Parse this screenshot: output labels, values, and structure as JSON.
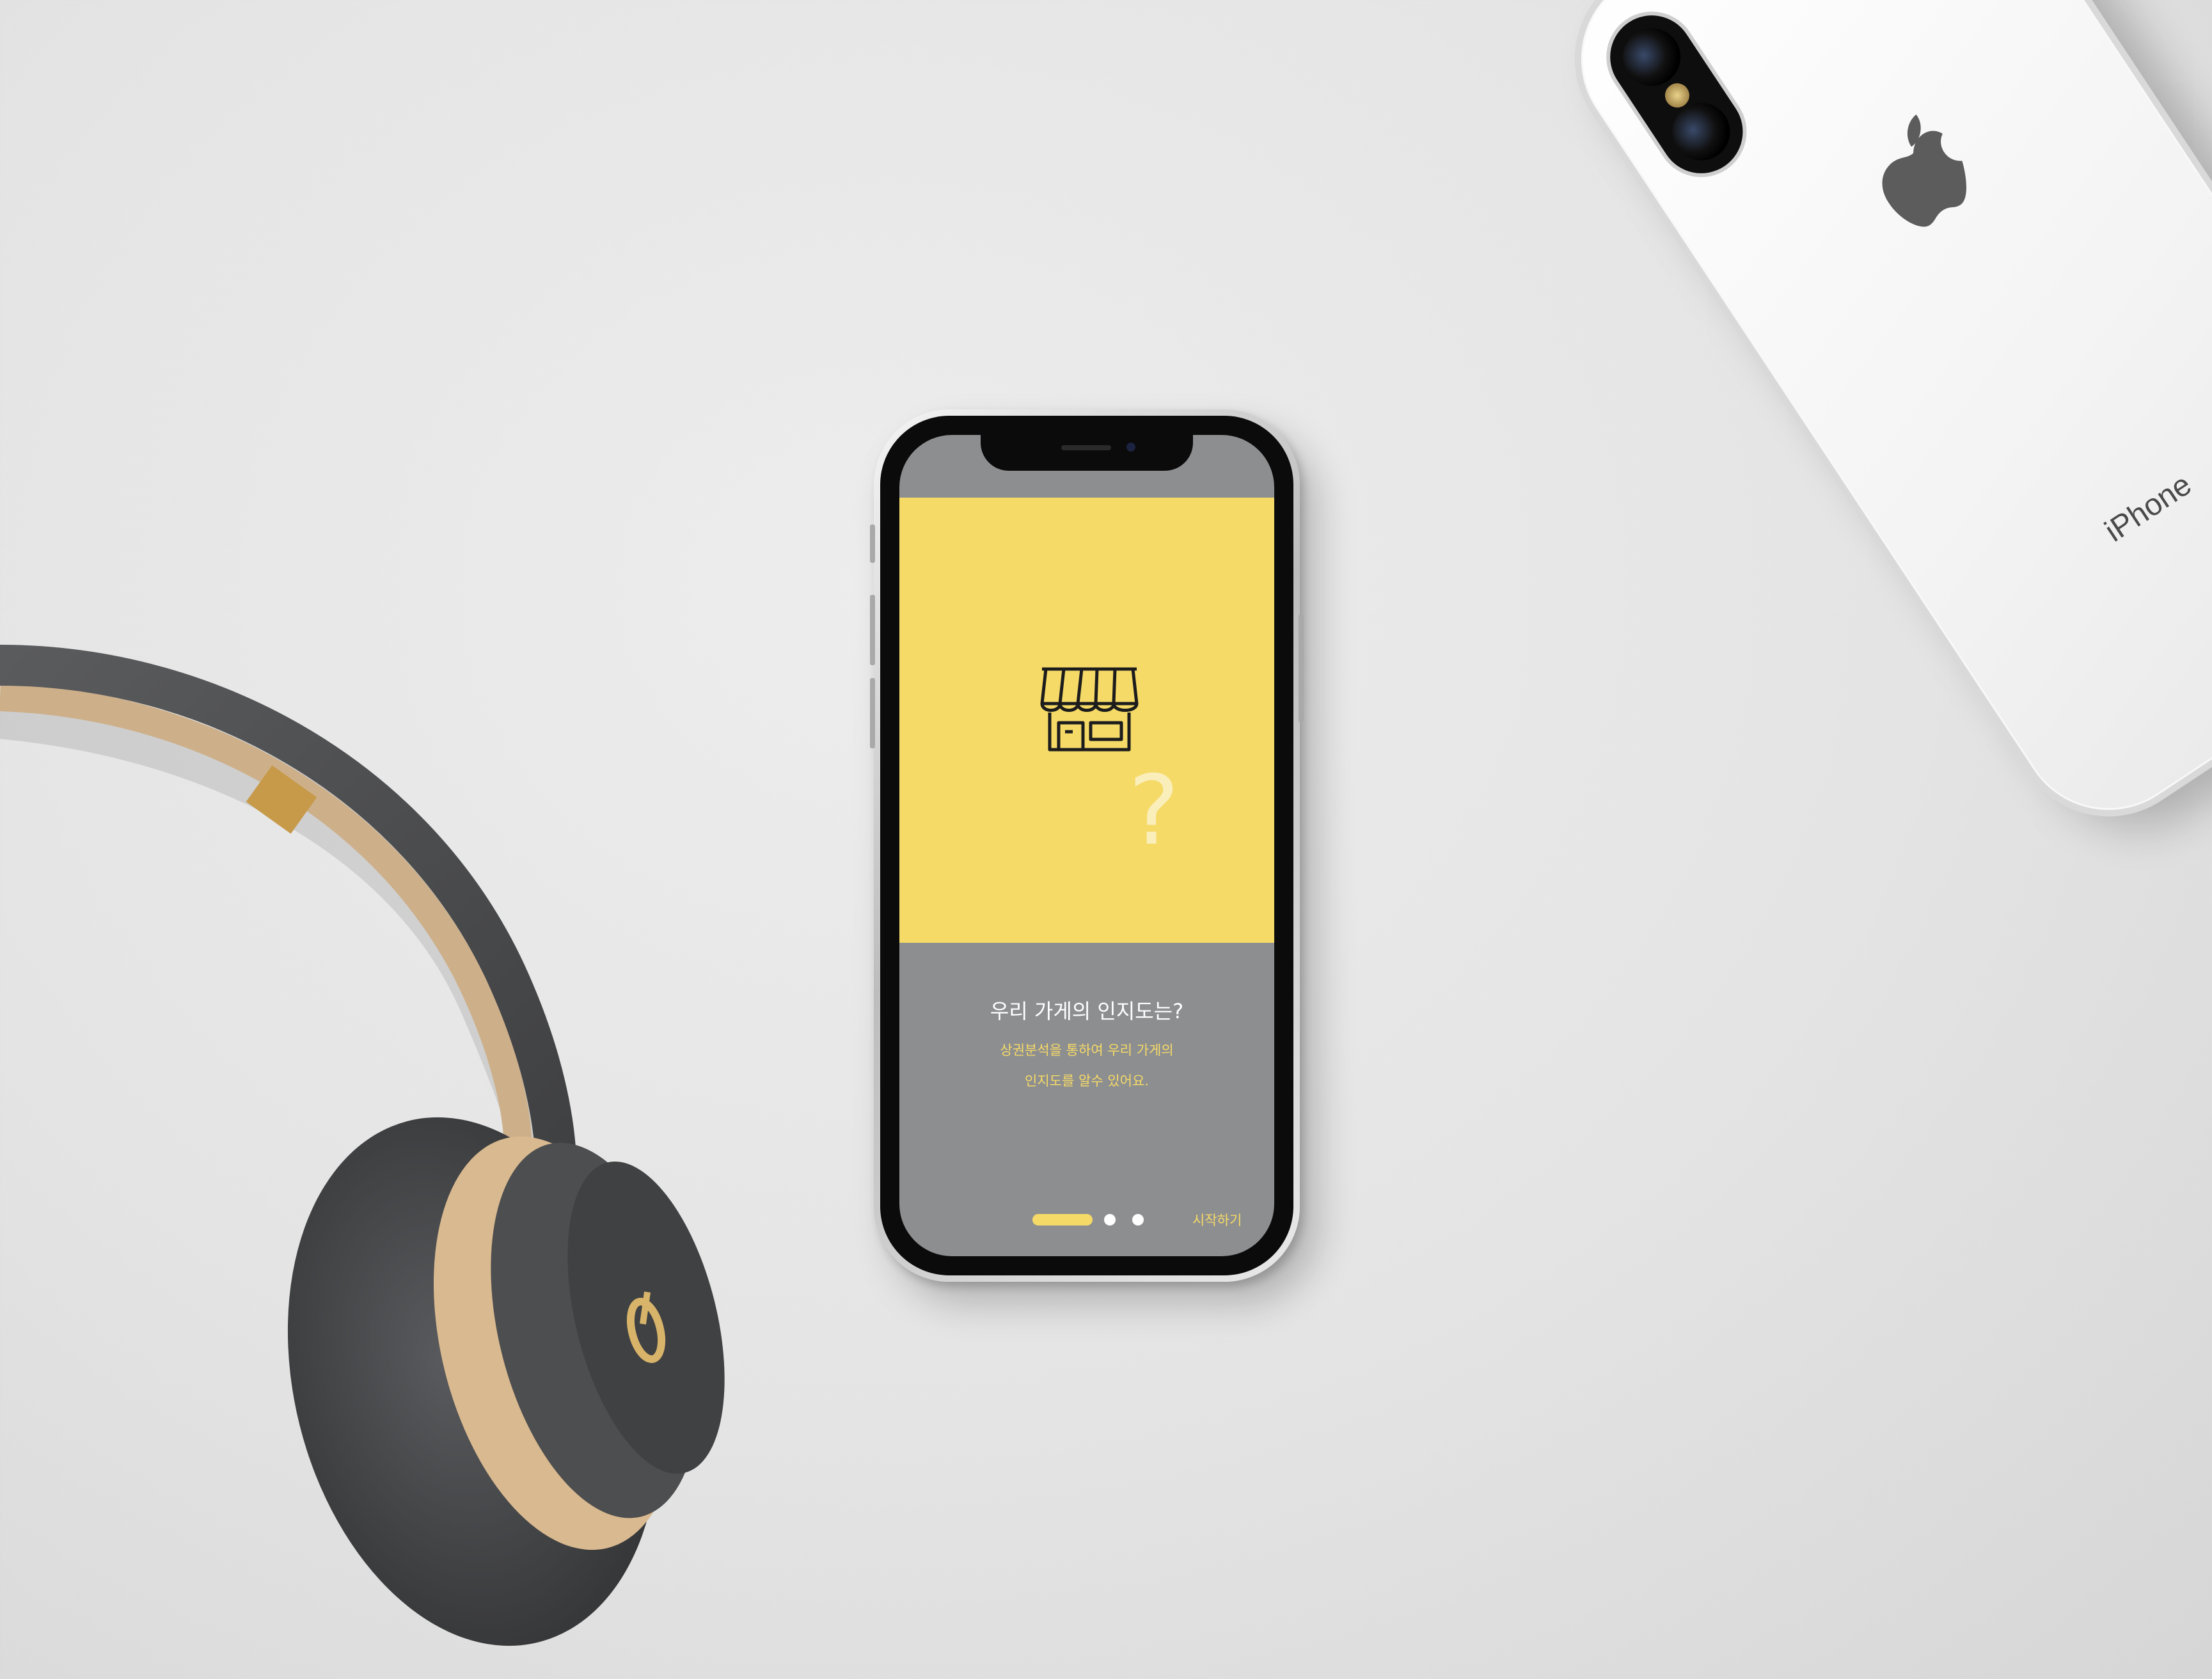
{
  "app_screen": {
    "title": "우리 가게의 인지도는?",
    "description_lines": [
      "상권분석을 통하여 우리 가게의",
      "인지도를 알수 있어요."
    ],
    "hero_mark": "?",
    "hero_icon": "store-icon",
    "start_label": "시작하기",
    "pager": {
      "total": 3,
      "active_index": 0
    }
  },
  "back_phone": {
    "brand_text": "iPhone",
    "logo_icon": "apple-logo-icon"
  },
  "colors": {
    "accent_yellow": "#f5da67",
    "screen_gray": "#8d8e90",
    "background": "#e4e4e4",
    "headphone_gray": "#4d4e50",
    "headphone_gold": "#d9b98f"
  }
}
